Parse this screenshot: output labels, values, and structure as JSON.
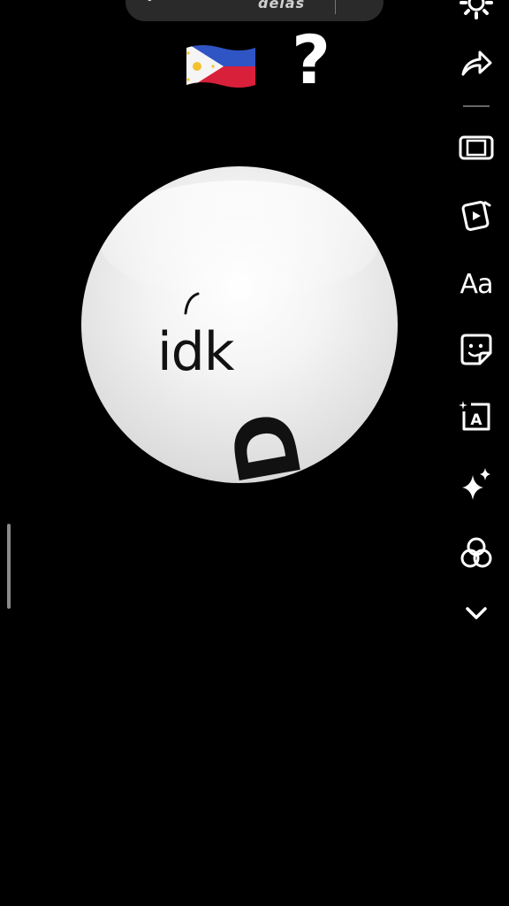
{
  "top_bar": {
    "note_icon": "music-note-icon",
    "text": "delas",
    "more_label": "···"
  },
  "overlay": {
    "flag_icon": "philippines-flag-icon",
    "question_mark": "?"
  },
  "sticker": {
    "label": "idk",
    "letter": "D"
  },
  "toolbar": {
    "items": [
      {
        "name": "settings-button",
        "icon": "gear-icon"
      },
      {
        "name": "share-button",
        "icon": "share-arrow-icon"
      },
      {
        "name": "resize-button",
        "icon": "resize-icon"
      },
      {
        "name": "clips-button",
        "icon": "clips-icon"
      },
      {
        "name": "text-button",
        "icon": "text-icon",
        "label": "Aa"
      },
      {
        "name": "sticker-button",
        "icon": "sticker-icon"
      },
      {
        "name": "captions-button",
        "icon": "captions-icon"
      },
      {
        "name": "effects-button",
        "icon": "sparkle-icon"
      },
      {
        "name": "filters-button",
        "icon": "filters-icon"
      },
      {
        "name": "more-button",
        "icon": "chevron-down-icon"
      }
    ]
  },
  "colors": {
    "background": "#000000",
    "pill": "#2a2a2a",
    "icon": "#ffffff"
  }
}
